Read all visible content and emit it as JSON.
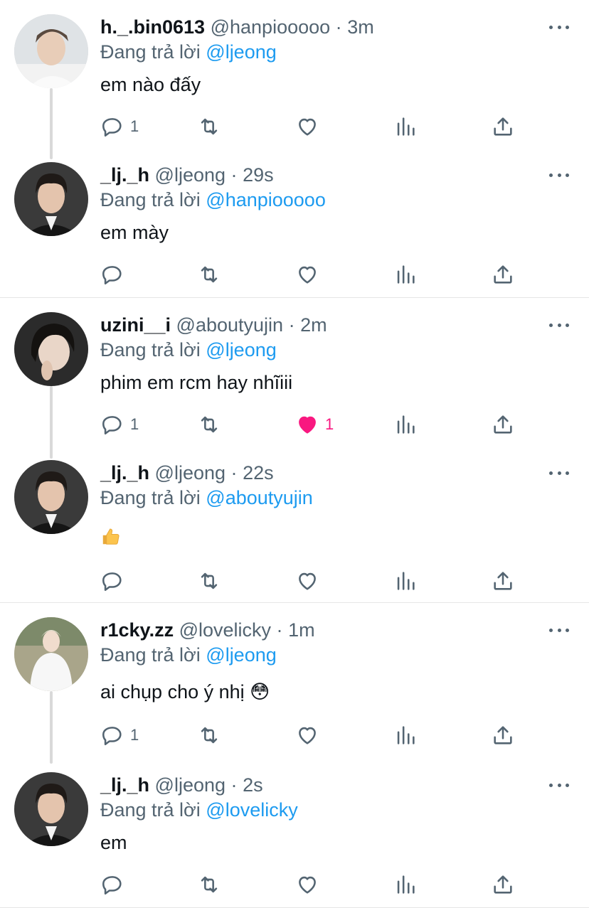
{
  "replying_prefix": "Đang trả lời",
  "colors": {
    "mention": "#1d9bf0",
    "like": "#f91880",
    "meta": "#536471"
  },
  "threads": [
    {
      "tweets": [
        {
          "name": "h._.bin0613",
          "handle": "@hanpiooooo",
          "time": "3m",
          "sep": "·",
          "reply_to": "@ljeong",
          "text": "em nào đấy",
          "reply_count": "1",
          "like_count": ""
        },
        {
          "name": "_lj._h",
          "handle": "@ljeong",
          "time": "29s",
          "sep": "·",
          "reply_to": "@hanpiooooo",
          "text": "em mày",
          "reply_count": "",
          "like_count": ""
        }
      ]
    },
    {
      "tweets": [
        {
          "name": "uzini__i",
          "handle": "@aboutyujin",
          "time": "2m",
          "sep": "·",
          "reply_to": "@ljeong",
          "text": "phim em rcm hay nhĩiii",
          "reply_count": "1",
          "like_count": "1"
        },
        {
          "name": "_lj._h",
          "handle": "@ljeong",
          "time": "22s",
          "sep": "·",
          "reply_to": "@aboutyujin",
          "text": "",
          "emoji": "thumbs-up",
          "reply_count": "",
          "like_count": ""
        }
      ]
    },
    {
      "tweets": [
        {
          "name": "r1cky.zz",
          "handle": "@lovelicky",
          "time": "1m",
          "sep": "·",
          "reply_to": "@ljeong",
          "text": "ai chụp cho ý nhị 😳",
          "reply_count": "1",
          "like_count": ""
        },
        {
          "name": "_lj._h",
          "handle": "@ljeong",
          "time": "2s",
          "sep": "·",
          "reply_to": "@lovelicky",
          "text": "em",
          "reply_count": "",
          "like_count": ""
        }
      ]
    }
  ]
}
